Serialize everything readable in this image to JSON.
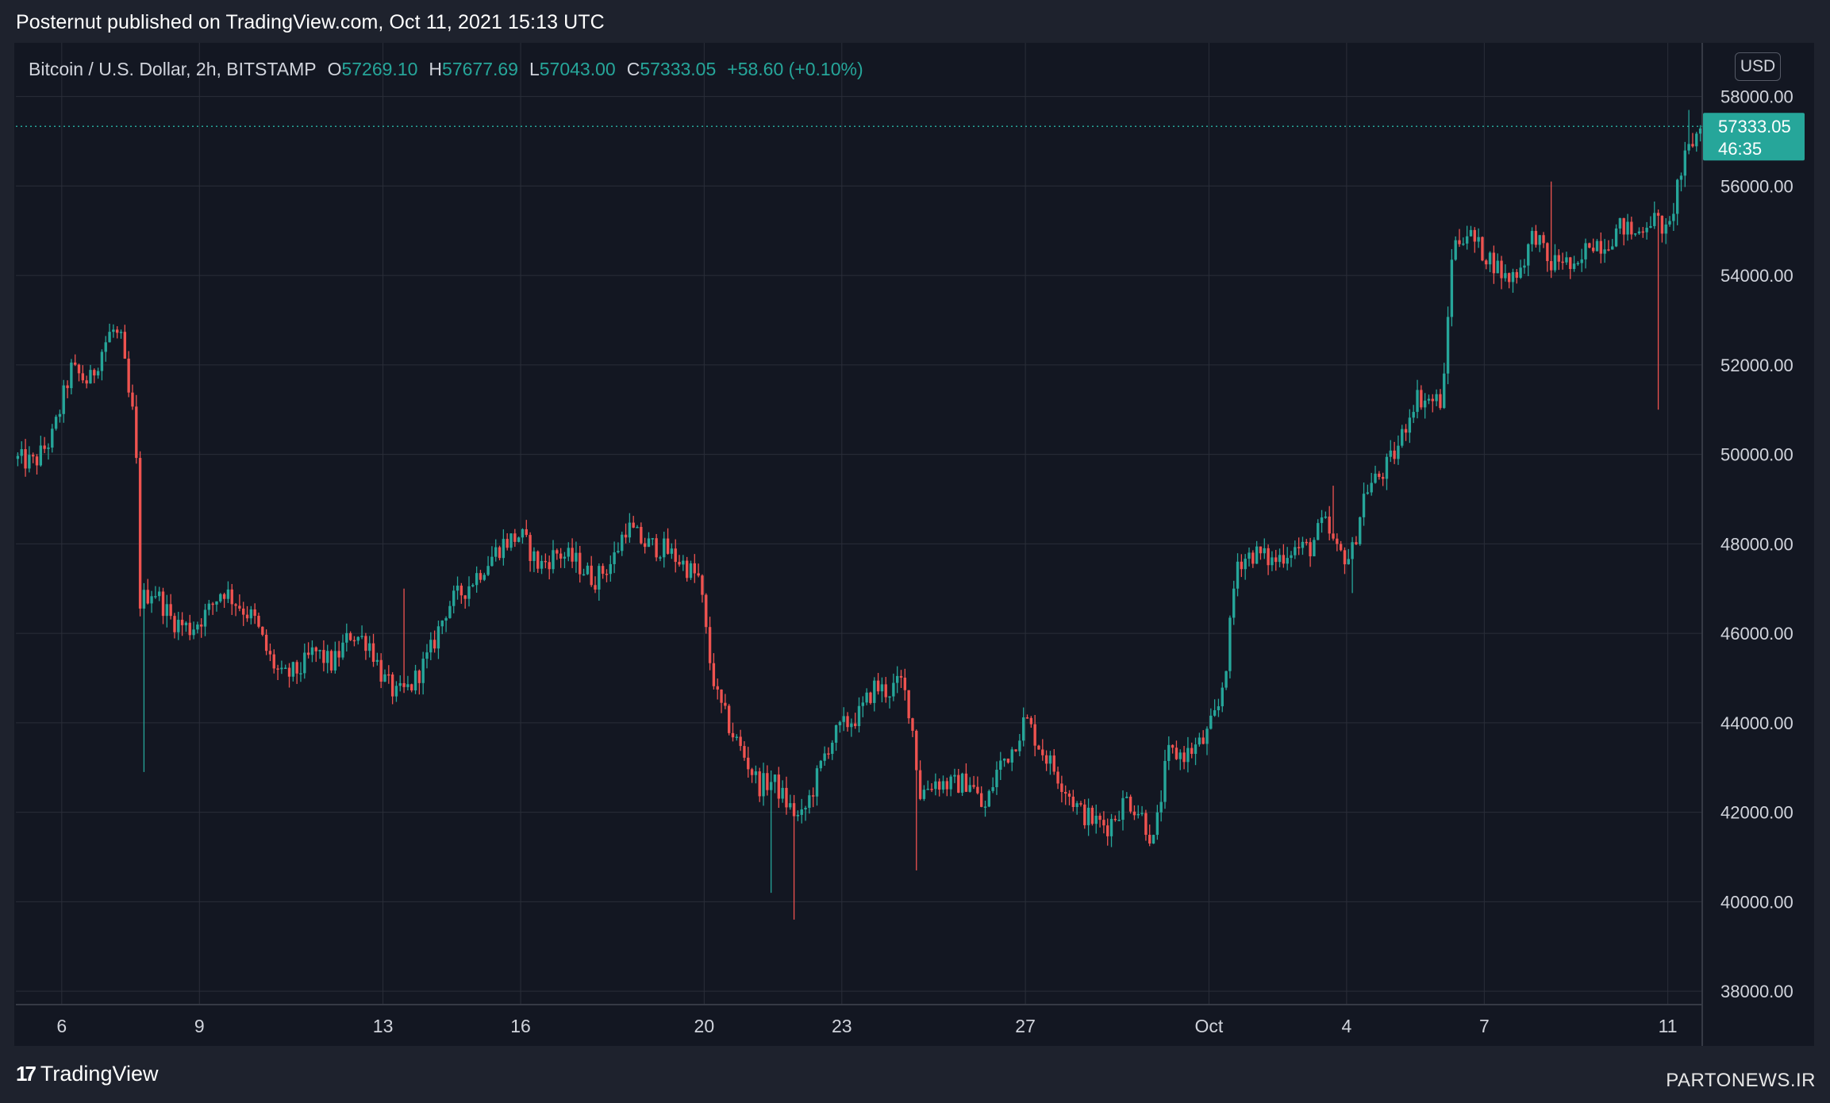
{
  "header": {
    "published": "Posternut published on TradingView.com, Oct 11, 2021 15:13 UTC"
  },
  "legend": {
    "symbol": "Bitcoin / U.S. Dollar, 2h, BITSTAMP",
    "open_label": "O",
    "open": "57269.10",
    "high_label": "H",
    "high": "57677.69",
    "low_label": "L",
    "low": "57043.00",
    "close_label": "C",
    "close": "57333.05",
    "change": "+58.60 (+0.10%)"
  },
  "currency_button": "USD",
  "price_tag": {
    "price": "57333.05",
    "countdown": "46:35"
  },
  "footer": {
    "logo_text": "TradingView",
    "watermark": "PARTONEWS.IR"
  },
  "colors": {
    "up": "#26a69a",
    "down": "#ef5350",
    "background": "#131722",
    "frame": "#1e222d",
    "grid": "#2a2e39",
    "axis_text": "#d1d4dc"
  },
  "chart_data": {
    "type": "candlestick",
    "title": "Bitcoin / U.S. Dollar, 2h, BITSTAMP",
    "ylim": [
      37700,
      59200
    ],
    "y_ticks": [
      38000,
      40000,
      42000,
      44000,
      46000,
      48000,
      50000,
      52000,
      54000,
      56000,
      58000
    ],
    "y_tick_labels": [
      "38000.00",
      "40000.00",
      "42000.00",
      "44000.00",
      "46000.00",
      "48000.00",
      "50000.00",
      "52000.00",
      "54000.00",
      "56000.00",
      "58000.00"
    ],
    "x_ticks": [
      {
        "label": "6",
        "day": 6
      },
      {
        "label": "9",
        "day": 9
      },
      {
        "label": "13",
        "day": 13
      },
      {
        "label": "16",
        "day": 16
      },
      {
        "label": "20",
        "day": 20
      },
      {
        "label": "23",
        "day": 23
      },
      {
        "label": "27",
        "day": 27
      },
      {
        "label": "Oct",
        "day": 31
      },
      {
        "label": "4",
        "day": 34
      },
      {
        "label": "7",
        "day": 37
      },
      {
        "label": "11",
        "day": 41
      }
    ],
    "x_domain_days": [
      5.0,
      41.75
    ],
    "last_price": 57333.05,
    "path": [
      [
        5.0,
        49900
      ],
      [
        5.4,
        49800
      ],
      [
        5.8,
        50400
      ],
      [
        6.2,
        51900
      ],
      [
        6.6,
        51600
      ],
      [
        6.9,
        52400
      ],
      [
        7.1,
        52800
      ],
      [
        7.3,
        52500
      ],
      [
        7.5,
        51000
      ],
      [
        7.6,
        50800
      ],
      [
        7.7,
        46700
      ],
      [
        8.0,
        47000
      ],
      [
        8.4,
        46300
      ],
      [
        8.8,
        46100
      ],
      [
        9.2,
        46500
      ],
      [
        9.5,
        47000
      ],
      [
        9.9,
        46600
      ],
      [
        10.2,
        46300
      ],
      [
        10.5,
        45500
      ],
      [
        10.8,
        45000
      ],
      [
        11.2,
        45200
      ],
      [
        11.5,
        45600
      ],
      [
        11.9,
        45300
      ],
      [
        12.3,
        46000
      ],
      [
        12.7,
        45800
      ],
      [
        13.0,
        45000
      ],
      [
        13.3,
        44600
      ],
      [
        13.6,
        44800
      ],
      [
        14.0,
        45500
      ],
      [
        14.4,
        46600
      ],
      [
        14.8,
        47000
      ],
      [
        15.2,
        47500
      ],
      [
        15.6,
        48000
      ],
      [
        16.0,
        48200
      ],
      [
        16.4,
        47500
      ],
      [
        16.8,
        47800
      ],
      [
        17.2,
        47600
      ],
      [
        17.6,
        47200
      ],
      [
        18.0,
        47600
      ],
      [
        18.3,
        48400
      ],
      [
        18.7,
        48000
      ],
      [
        19.1,
        47900
      ],
      [
        19.5,
        47600
      ],
      [
        19.9,
        47200
      ],
      [
        20.1,
        45500
      ],
      [
        20.3,
        44500
      ],
      [
        20.6,
        43800
      ],
      [
        20.9,
        43200
      ],
      [
        21.2,
        42600
      ],
      [
        21.5,
        42700
      ],
      [
        21.8,
        42200
      ],
      [
        22.1,
        41800
      ],
      [
        22.4,
        42600
      ],
      [
        22.7,
        43500
      ],
      [
        23.0,
        43900
      ],
      [
        23.4,
        44200
      ],
      [
        23.7,
        44800
      ],
      [
        24.0,
        44700
      ],
      [
        24.3,
        44900
      ],
      [
        24.5,
        44200
      ],
      [
        24.7,
        42400
      ],
      [
        25.0,
        42700
      ],
      [
        25.4,
        42600
      ],
      [
        25.8,
        42700
      ],
      [
        26.1,
        42000
      ],
      [
        26.4,
        43000
      ],
      [
        26.7,
        43400
      ],
      [
        27.0,
        44100
      ],
      [
        27.3,
        43500
      ],
      [
        27.6,
        43000
      ],
      [
        27.9,
        42500
      ],
      [
        28.2,
        42000
      ],
      [
        28.5,
        41800
      ],
      [
        28.8,
        41700
      ],
      [
        29.2,
        42300
      ],
      [
        29.5,
        42000
      ],
      [
        29.8,
        41300
      ],
      [
        30.1,
        43300
      ],
      [
        30.5,
        43300
      ],
      [
        30.9,
        43600
      ],
      [
        31.2,
        44300
      ],
      [
        31.4,
        45500
      ],
      [
        31.6,
        47600
      ],
      [
        32.0,
        47800
      ],
      [
        32.4,
        47600
      ],
      [
        32.8,
        47900
      ],
      [
        33.2,
        47900
      ],
      [
        33.5,
        48500
      ],
      [
        33.8,
        47800
      ],
      [
        34.1,
        47700
      ],
      [
        34.4,
        49200
      ],
      [
        34.8,
        49600
      ],
      [
        35.1,
        50100
      ],
      [
        35.5,
        51300
      ],
      [
        35.8,
        51200
      ],
      [
        36.1,
        51200
      ],
      [
        36.3,
        54600
      ],
      [
        36.6,
        55000
      ],
      [
        36.9,
        54600
      ],
      [
        37.2,
        54300
      ],
      [
        37.5,
        53900
      ],
      [
        37.8,
        54200
      ],
      [
        38.1,
        55000
      ],
      [
        38.4,
        54200
      ],
      [
        38.7,
        54400
      ],
      [
        39.0,
        54000
      ],
      [
        39.3,
        54800
      ],
      [
        39.6,
        54700
      ],
      [
        40.0,
        55100
      ],
      [
        40.3,
        54900
      ],
      [
        40.6,
        55300
      ],
      [
        40.9,
        55100
      ],
      [
        41.0,
        54800
      ],
      [
        41.2,
        56000
      ],
      [
        41.45,
        56800
      ],
      [
        41.6,
        57100
      ],
      [
        41.72,
        57333
      ]
    ],
    "notable_wicks": [
      {
        "day": 7.75,
        "low": 42900
      },
      {
        "day": 21.45,
        "low": 40200
      },
      {
        "day": 21.95,
        "low": 39600
      },
      {
        "day": 13.5,
        "high": 47000
      },
      {
        "day": 24.65,
        "low": 40700
      },
      {
        "day": 33.7,
        "high": 49300
      },
      {
        "day": 34.1,
        "low": 46900
      },
      {
        "day": 38.5,
        "high": 56100
      },
      {
        "day": 40.8,
        "low": 51000
      },
      {
        "day": 41.5,
        "high": 57700
      }
    ]
  }
}
